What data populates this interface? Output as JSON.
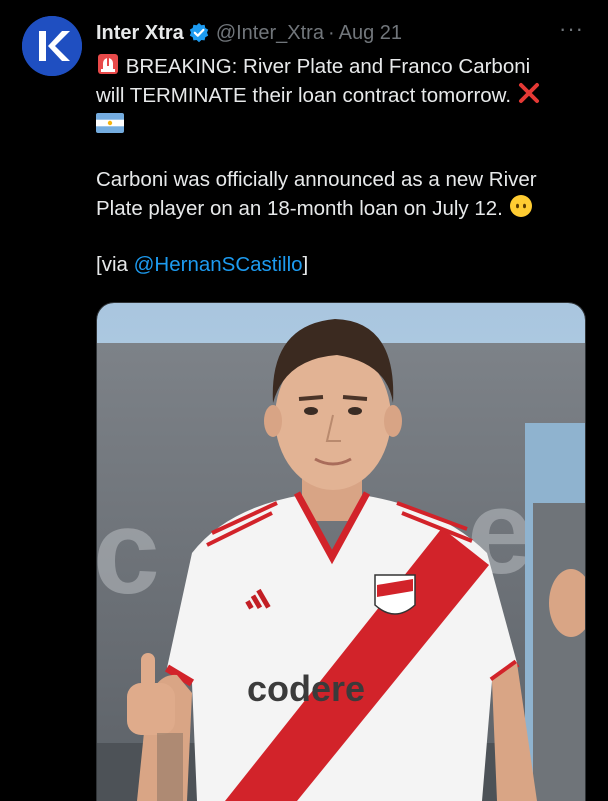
{
  "author": {
    "display_name": "Inter Xtra",
    "handle": "@Inter_Xtra",
    "separator": "·",
    "date": "Aug 21",
    "avatar_icon": "inter-xtra-logo",
    "verified_icon": "verified-badge-icon",
    "more_label": "···"
  },
  "tweet": {
    "line1_text": "BREAKING: River Plate and Franco Carboni",
    "line2_text": "will TERMINATE their loan contract tomorrow.",
    "line4_text": "Carboni was officially announced as a new River",
    "line5_text": "Plate player on an 18-month loan on July 12.",
    "via_prefix": "[via ",
    "mention": "@HernanSCastillo",
    "via_suffix": "]",
    "emojis": [
      "rotating-light-emoji",
      "cross-mark-emoji",
      "argentina-flag-emoji",
      "no-mouth-face-emoji"
    ]
  },
  "media": {
    "alt_icon": "player-photo",
    "sponsor_text": "codere"
  },
  "colors": {
    "background": "#000000",
    "text": "#e7e9ea",
    "muted": "#71767b",
    "link": "#1d9bf0",
    "avatar": "#1f4fc1",
    "river_red": "#d2232a"
  }
}
